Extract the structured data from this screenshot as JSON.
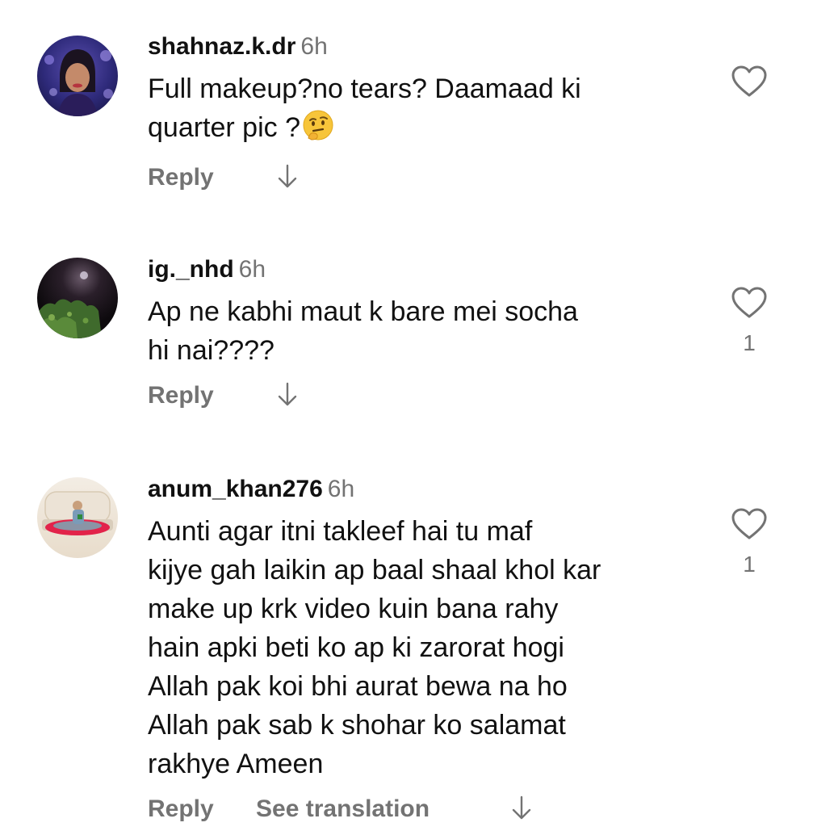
{
  "comments": [
    {
      "username": "shahnaz.k.dr",
      "time": "6h",
      "text_lines": [
        "Full makeup?no tears? Daamaad ki",
        "quarter pic ?"
      ],
      "emoji": "thinking-face",
      "reply_label": "Reply",
      "like_count": ""
    },
    {
      "username": "ig._nhd",
      "time": "6h",
      "text_lines": [
        "Ap ne kabhi maut k bare mei socha",
        "hi nai????"
      ],
      "reply_label": "Reply",
      "like_count": "1"
    },
    {
      "username": "anum_khan276",
      "time": "6h",
      "text_lines": [
        "Aunti agar itni takleef hai tu maf",
        "kijye gah laikin ap baal shaal khol kar",
        "make up krk video kuin bana rahy",
        "hain apki beti ko ap ki zarorat hogi",
        "Allah pak koi bhi aurat bewa na ho",
        "Allah pak sab k shohar ko salamat",
        "rakhye Ameen"
      ],
      "reply_label": "Reply",
      "translation_label": "See translation",
      "like_count": "1"
    }
  ],
  "colors": {
    "text": "#111111",
    "secondary": "#737373",
    "background": "#ffffff"
  },
  "icons": {
    "like": "heart-outline-icon",
    "translate": "arrow-down-icon"
  }
}
